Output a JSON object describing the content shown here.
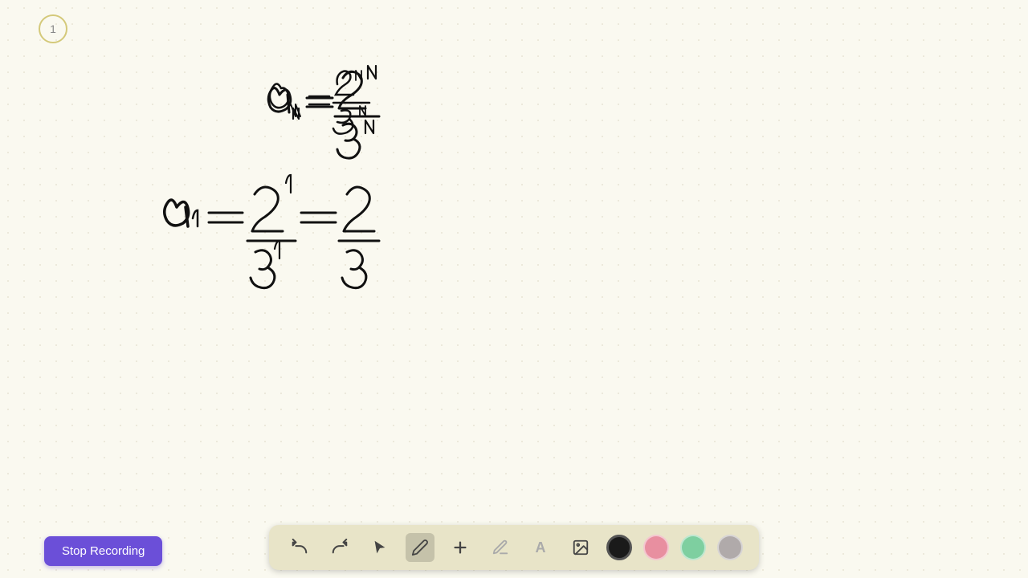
{
  "page": {
    "number": "1",
    "background": "#faf9f0"
  },
  "stop_recording": {
    "label": "Stop Recording"
  },
  "toolbar": {
    "undo_label": "↩",
    "redo_label": "↪",
    "select_label": "▲",
    "pen_label": "✏",
    "add_label": "+",
    "highlight_label": "◻",
    "text_label": "A",
    "image_label": "🖼",
    "colors": [
      {
        "name": "black",
        "hex": "#1a1a1a",
        "selected": true
      },
      {
        "name": "pink",
        "hex": "#e88fa0",
        "selected": false
      },
      {
        "name": "green",
        "hex": "#7ecfa0",
        "selected": false
      },
      {
        "name": "gray",
        "hex": "#b0aaaa",
        "selected": false
      }
    ]
  }
}
